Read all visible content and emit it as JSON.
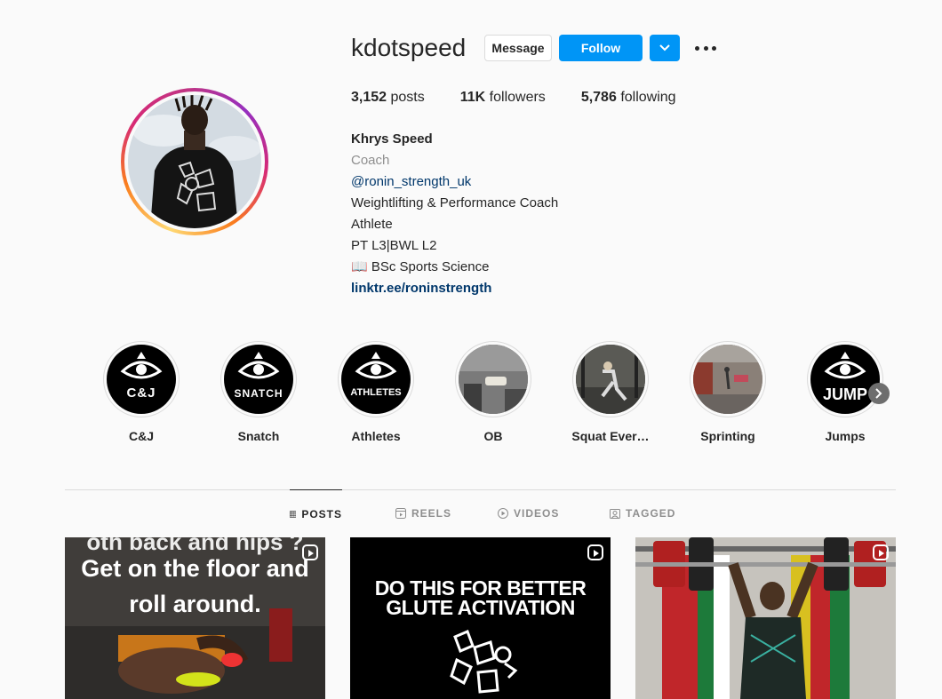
{
  "profile": {
    "username": "kdotspeed",
    "message_label": "Message",
    "follow_label": "Follow",
    "dropdown_icon": "chevron-down-icon",
    "more_icon": "more-options-icon",
    "stats": {
      "posts_count": "3,152",
      "posts_label": "posts",
      "followers_count": "11K",
      "followers_label": "followers",
      "following_count": "5,786",
      "following_label": "following"
    },
    "bio": {
      "name": "Khrys Speed",
      "category": "Coach",
      "mention": "@ronin_strength_uk",
      "line1": "Weightlifting & Performance Coach",
      "line2": "Athlete",
      "line3": "PT L3|BWL L2",
      "line4": "📖 BSc Sports Science",
      "link": "linktr.ee/roninstrength"
    }
  },
  "highlights": [
    {
      "label": "C&J",
      "badge": "C&J"
    },
    {
      "label": "Snatch",
      "badge": "SNATCH"
    },
    {
      "label": "Athletes",
      "badge": "ATHLETES"
    },
    {
      "label": "OB"
    },
    {
      "label": "Squat Ever…"
    },
    {
      "label": "Sprinting"
    },
    {
      "label": "Jumps",
      "badge": "JUMP"
    }
  ],
  "tabs": [
    {
      "label": "POSTS",
      "icon": "grid-icon"
    },
    {
      "label": "REELS",
      "icon": "reels-icon"
    },
    {
      "label": "VIDEOS",
      "icon": "video-icon"
    },
    {
      "label": "TAGGED",
      "icon": "tagged-icon"
    }
  ],
  "posts": [
    {
      "caption_top": "oth back and hips ?",
      "caption_1": "Get on the floor and",
      "caption_2": "roll around."
    },
    {
      "caption_1": "DO THIS FOR BETTER",
      "caption_2": "GLUTE ACTIVATION"
    },
    {}
  ],
  "colors": {
    "accent": "#0095f6",
    "link": "#00376b",
    "muted": "#8e8e8e",
    "text": "#262626",
    "background": "#fafafa"
  }
}
